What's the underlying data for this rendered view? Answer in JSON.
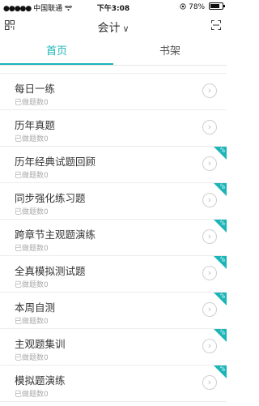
{
  "status_bar": {
    "signal": "●●●●●",
    "carrier": "中国联通",
    "wifi": "wifi-icon",
    "time": "下午3:08",
    "location": "location-icon",
    "battery_percent": "78%",
    "battery_level": 0.78
  },
  "nav": {
    "title": "会计",
    "chevron": "∨"
  },
  "tabs": [
    {
      "label": "首页",
      "active": true
    },
    {
      "label": "书架",
      "active": false
    }
  ],
  "list": {
    "items": [
      {
        "name": "每日一练",
        "count": "已做题数0",
        "badge": false
      },
      {
        "name": "历年真题",
        "count": "已做题数0",
        "badge": false
      },
      {
        "name": "历年经典试题回顾",
        "count": "已做题数0",
        "badge": true
      },
      {
        "name": "同步强化练习题",
        "count": "已做题数0",
        "badge": true
      },
      {
        "name": "跨章节主观题演练",
        "count": "已做题数0",
        "badge": true
      },
      {
        "name": "全真模拟测试题",
        "count": "已做题数0",
        "badge": true
      },
      {
        "name": "本周自测",
        "count": "已做题数0",
        "badge": true
      },
      {
        "name": "主观题集训",
        "count": "已做题数0",
        "badge": true
      },
      {
        "name": "模拟题演练",
        "count": "已做题数0",
        "badge": true
      }
    ],
    "arrow_glyph": "›",
    "badge_text": "vip"
  },
  "colors": {
    "accent": "#1bb5b8",
    "divider": "#ececec"
  }
}
